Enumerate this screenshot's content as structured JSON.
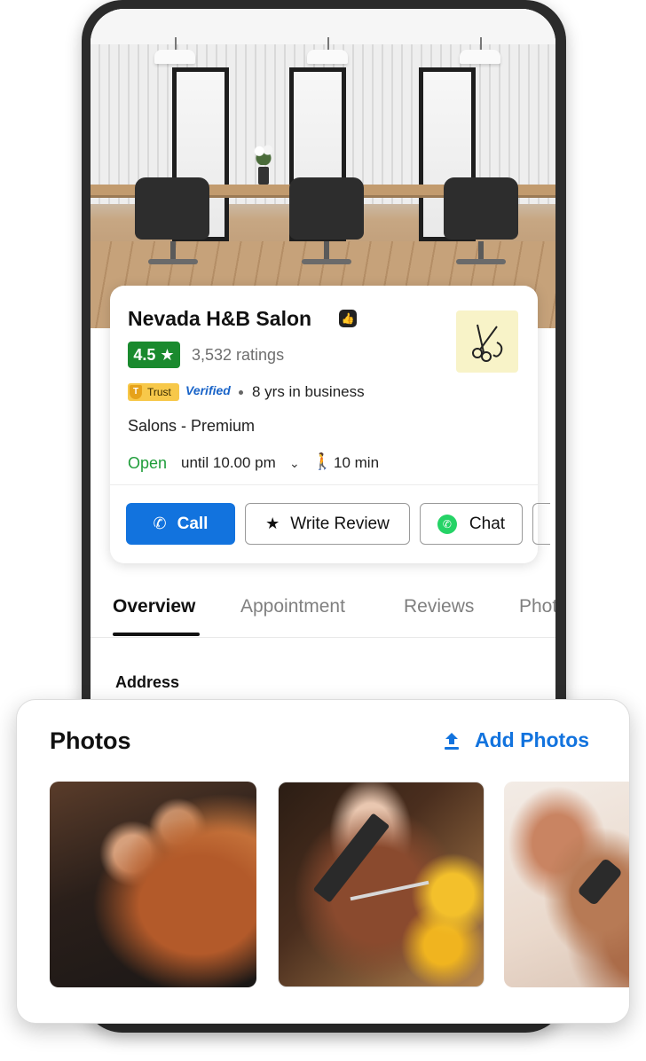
{
  "business": {
    "name": "Nevada H&B Salon",
    "rating": "4.5 ★",
    "ratings_count": "3,532 ratings",
    "trust_label": "Trust",
    "verified_label": "Verified",
    "years_in_business": "8 yrs in business",
    "category": "Salons - Premium",
    "open_status": "Open",
    "open_until": "until 10.00 pm",
    "walk_time": "10 min"
  },
  "actions": {
    "call_label": "Call",
    "write_review_label": "Write Review",
    "chat_label": "Chat"
  },
  "tabs": [
    {
      "label": "Overview",
      "active": true
    },
    {
      "label": "Appointment"
    },
    {
      "label": "Reviews"
    },
    {
      "label": "Photos"
    }
  ],
  "sections": {
    "address_heading": "Address"
  },
  "photos": {
    "title": "Photos",
    "add_label": "Add Photos"
  },
  "colors": {
    "primary": "#1273de",
    "rating_green": "#1a8a2e",
    "open_green": "#1f9d3a",
    "trust_yellow": "#f7c84a"
  }
}
